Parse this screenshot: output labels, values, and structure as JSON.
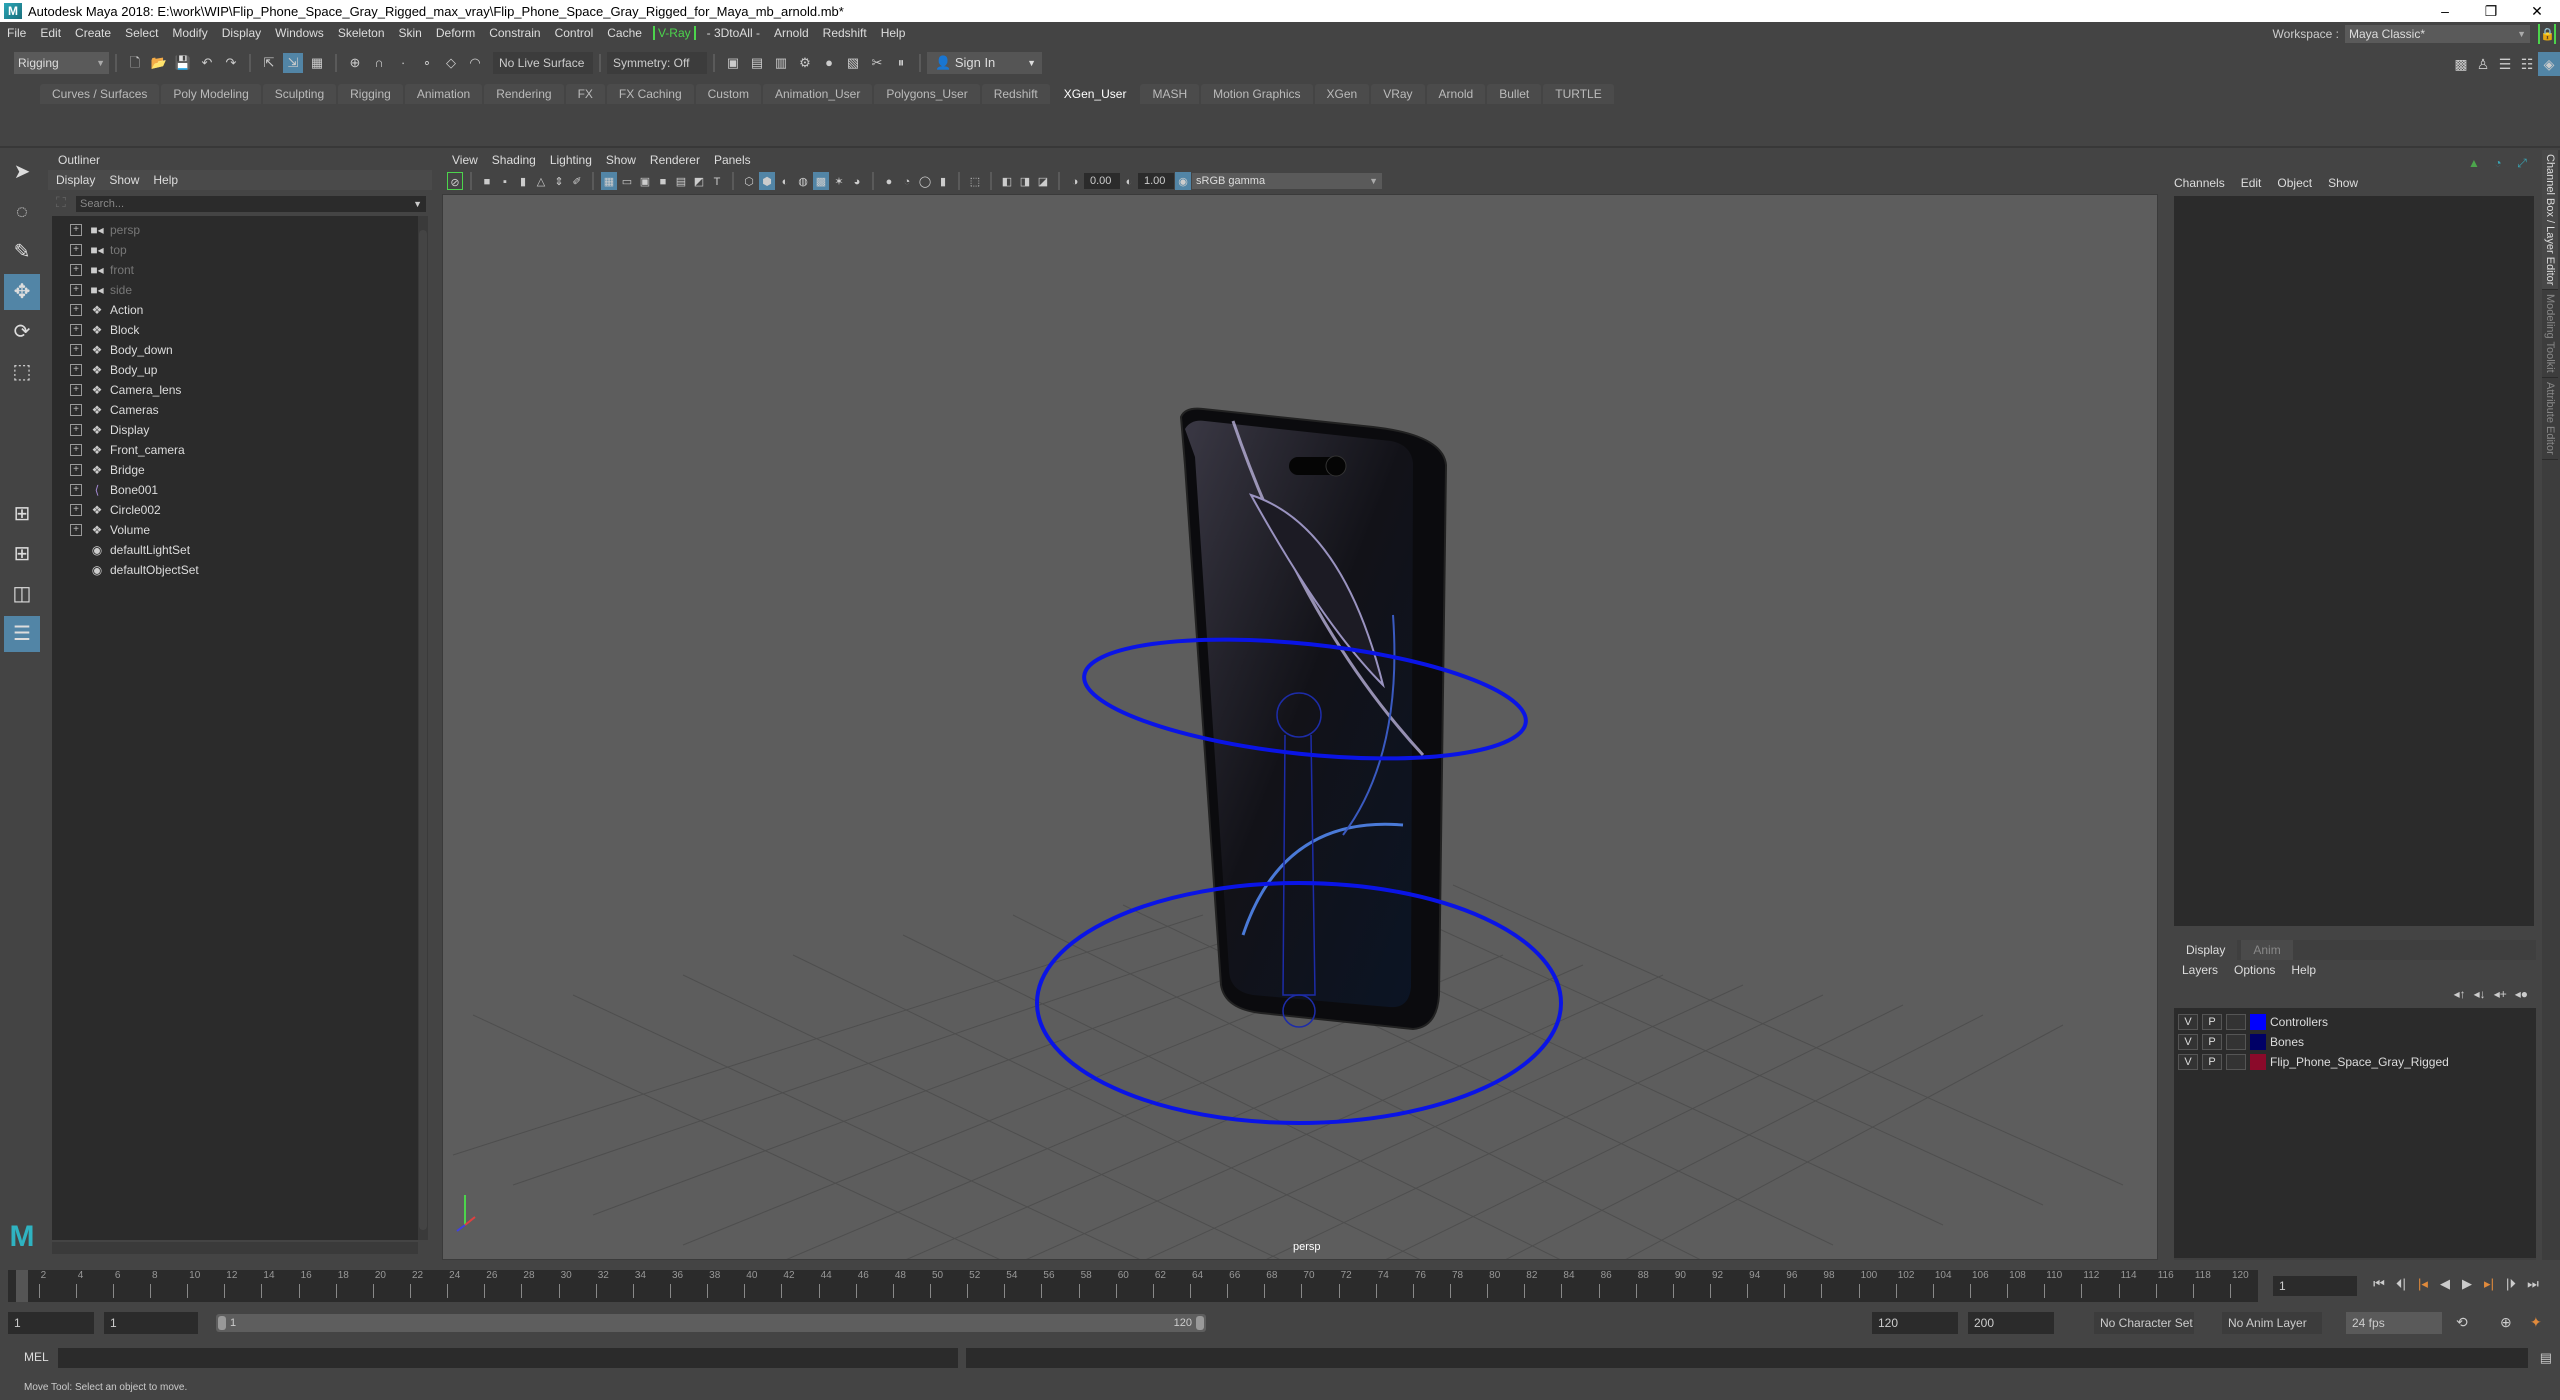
{
  "window": {
    "title": "Autodesk Maya 2018: E:\\work\\WIP\\Flip_Phone_Space_Gray_Rigged_max_vray\\Flip_Phone_Space_Gray_Rigged_for_Maya_mb_arnold.mb*",
    "logo": "M",
    "minimize": "–",
    "maximize": "❐",
    "close": "✕"
  },
  "menubar": [
    "File",
    "Edit",
    "Create",
    "Select",
    "Modify",
    "Display",
    "Windows",
    "Skeleton",
    "Skin",
    "Deform",
    "Constrain",
    "Control",
    "Cache"
  ],
  "menubar_vray": "V-Ray",
  "menubar_extra": [
    "- 3DtoAll -",
    "Arnold",
    "Redshift",
    "Help"
  ],
  "workspace": {
    "label": "Workspace :",
    "value": "Maya Classic*"
  },
  "statusline": {
    "mode": "Rigging",
    "live_surface": "No Live Surface",
    "symmetry": "Symmetry: Off",
    "signin": "Sign In"
  },
  "shelf_tabs": [
    "Curves / Surfaces",
    "Poly Modeling",
    "Sculpting",
    "Rigging",
    "Animation",
    "Rendering",
    "FX",
    "FX Caching",
    "Custom",
    "Animation_User",
    "Polygons_User",
    "Redshift",
    "XGen_User",
    "MASH",
    "Motion Graphics",
    "XGen",
    "VRay",
    "Arnold",
    "Bullet",
    "TURTLE"
  ],
  "shelf_active": "XGen_User",
  "outliner": {
    "title": "Outliner",
    "menu": [
      "Display",
      "Show",
      "Help"
    ],
    "search_placeholder": "Search...",
    "items": [
      {
        "label": "persp",
        "type": "camera"
      },
      {
        "label": "top",
        "type": "camera"
      },
      {
        "label": "front",
        "type": "camera"
      },
      {
        "label": "side",
        "type": "camera"
      },
      {
        "label": "Action",
        "type": "group"
      },
      {
        "label": "Block",
        "type": "group"
      },
      {
        "label": "Body_down",
        "type": "group"
      },
      {
        "label": "Body_up",
        "type": "group"
      },
      {
        "label": "Camera_lens",
        "type": "group"
      },
      {
        "label": "Cameras",
        "type": "group"
      },
      {
        "label": "Display",
        "type": "group"
      },
      {
        "label": "Front_camera",
        "type": "group"
      },
      {
        "label": "Bridge",
        "type": "group"
      },
      {
        "label": "Bone001",
        "type": "joint"
      },
      {
        "label": "Circle002",
        "type": "group"
      },
      {
        "label": "Volume",
        "type": "group"
      },
      {
        "label": "defaultLightSet",
        "type": "set"
      },
      {
        "label": "defaultObjectSet",
        "type": "set"
      }
    ]
  },
  "viewport": {
    "menu": [
      "View",
      "Shading",
      "Lighting",
      "Show",
      "Renderer",
      "Panels"
    ],
    "exposure": "0.00",
    "gamma": "1.00",
    "colorspace": "sRGB gamma",
    "camera_label": "persp",
    "axis": {
      "y": "y",
      "x": "x",
      "z": "z"
    }
  },
  "channelbox": {
    "menu": [
      "Channels",
      "Edit",
      "Object",
      "Show"
    ]
  },
  "layer_editor": {
    "tabs": [
      "Display",
      "Anim"
    ],
    "menu": [
      "Layers",
      "Options",
      "Help"
    ],
    "layers": [
      {
        "v": "V",
        "p": "P",
        "color": "#0000ff",
        "name": "Controllers"
      },
      {
        "v": "V",
        "p": "P",
        "color": "#000066",
        "name": "Bones"
      },
      {
        "v": "V",
        "p": "P",
        "color": "#8b0a2a",
        "name": "Flip_Phone_Space_Gray_Rigged"
      }
    ]
  },
  "side_tabs": [
    "Channel Box / Layer Editor",
    "Modeling Toolkit",
    "Attribute Editor"
  ],
  "timeline": {
    "start": 1,
    "end": 120,
    "current_frame": "1",
    "tick_labels": [
      2,
      4,
      6,
      8,
      10,
      12,
      14,
      16,
      18,
      20,
      22,
      24,
      26,
      28,
      30,
      32,
      34,
      36,
      38,
      40,
      42,
      44,
      46,
      48,
      50,
      52,
      54,
      56,
      58,
      60,
      62,
      64,
      66,
      68,
      70,
      72,
      74,
      76,
      78,
      80,
      82,
      84,
      86,
      88,
      90,
      92,
      94,
      96,
      98,
      100,
      102,
      104,
      106,
      108,
      110,
      112,
      114,
      116,
      118,
      120
    ]
  },
  "range": {
    "start_field": "1",
    "playback_start": "1",
    "slider_start": "1",
    "slider_end": "120",
    "playback_end": "120",
    "end_field": "200",
    "character_set": "No Character Set",
    "anim_layer": "No Anim Layer",
    "fps": "24 fps"
  },
  "command": {
    "label": "MEL"
  },
  "help_line": "Move Tool: Select an object to move."
}
